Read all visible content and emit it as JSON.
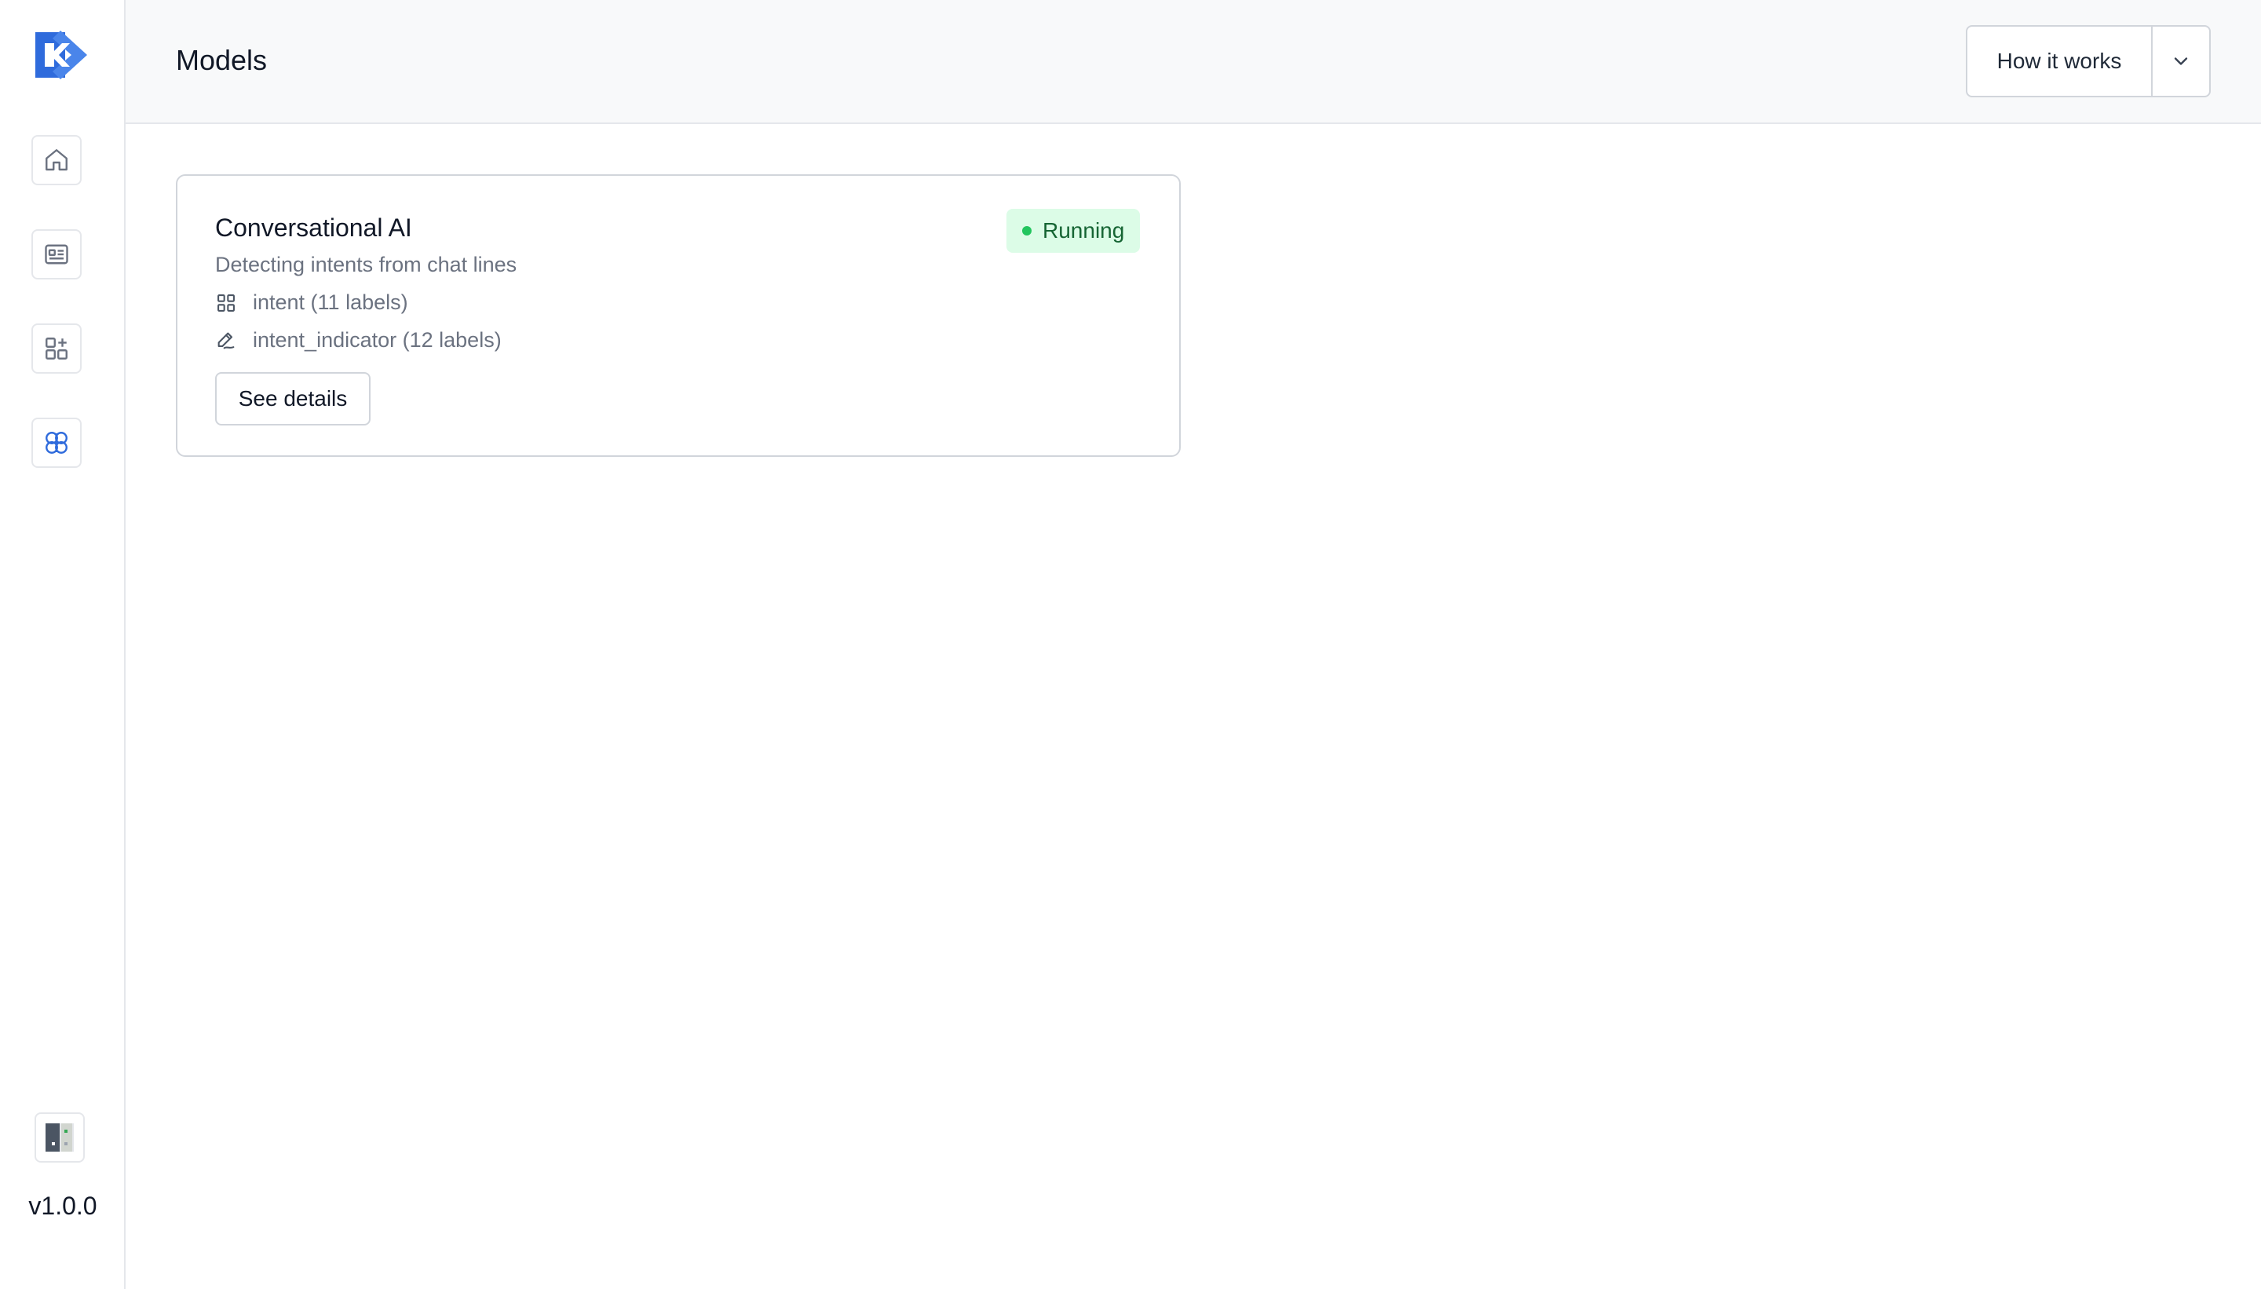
{
  "sidebar": {
    "logo_icon": "kaizen-logo-icon",
    "nav_items": [
      {
        "icon": "home-icon"
      },
      {
        "icon": "id-card-icon"
      },
      {
        "icon": "apps-add-icon"
      },
      {
        "icon": "brain-icon",
        "active": true
      }
    ],
    "vendor_icon": "vendor-logo-icon",
    "version": "v1.0.0"
  },
  "header": {
    "title": "Models",
    "help_button_label": "How it works",
    "help_toggle_icon": "chevron-down-icon"
  },
  "models": [
    {
      "name": "Conversational AI",
      "description": "Detecting intents from chat lines",
      "status": "Running",
      "status_color": "#22c55e",
      "tasks": [
        {
          "icon": "grid-icon",
          "label": "intent (11 labels)"
        },
        {
          "icon": "pen-icon",
          "label": "intent_indicator (12 labels)"
        }
      ],
      "details_label": "See details"
    }
  ],
  "colors": {
    "accent": "#3b6fd4",
    "status_running_bg": "#dcfce7",
    "status_running_text": "#166534"
  }
}
